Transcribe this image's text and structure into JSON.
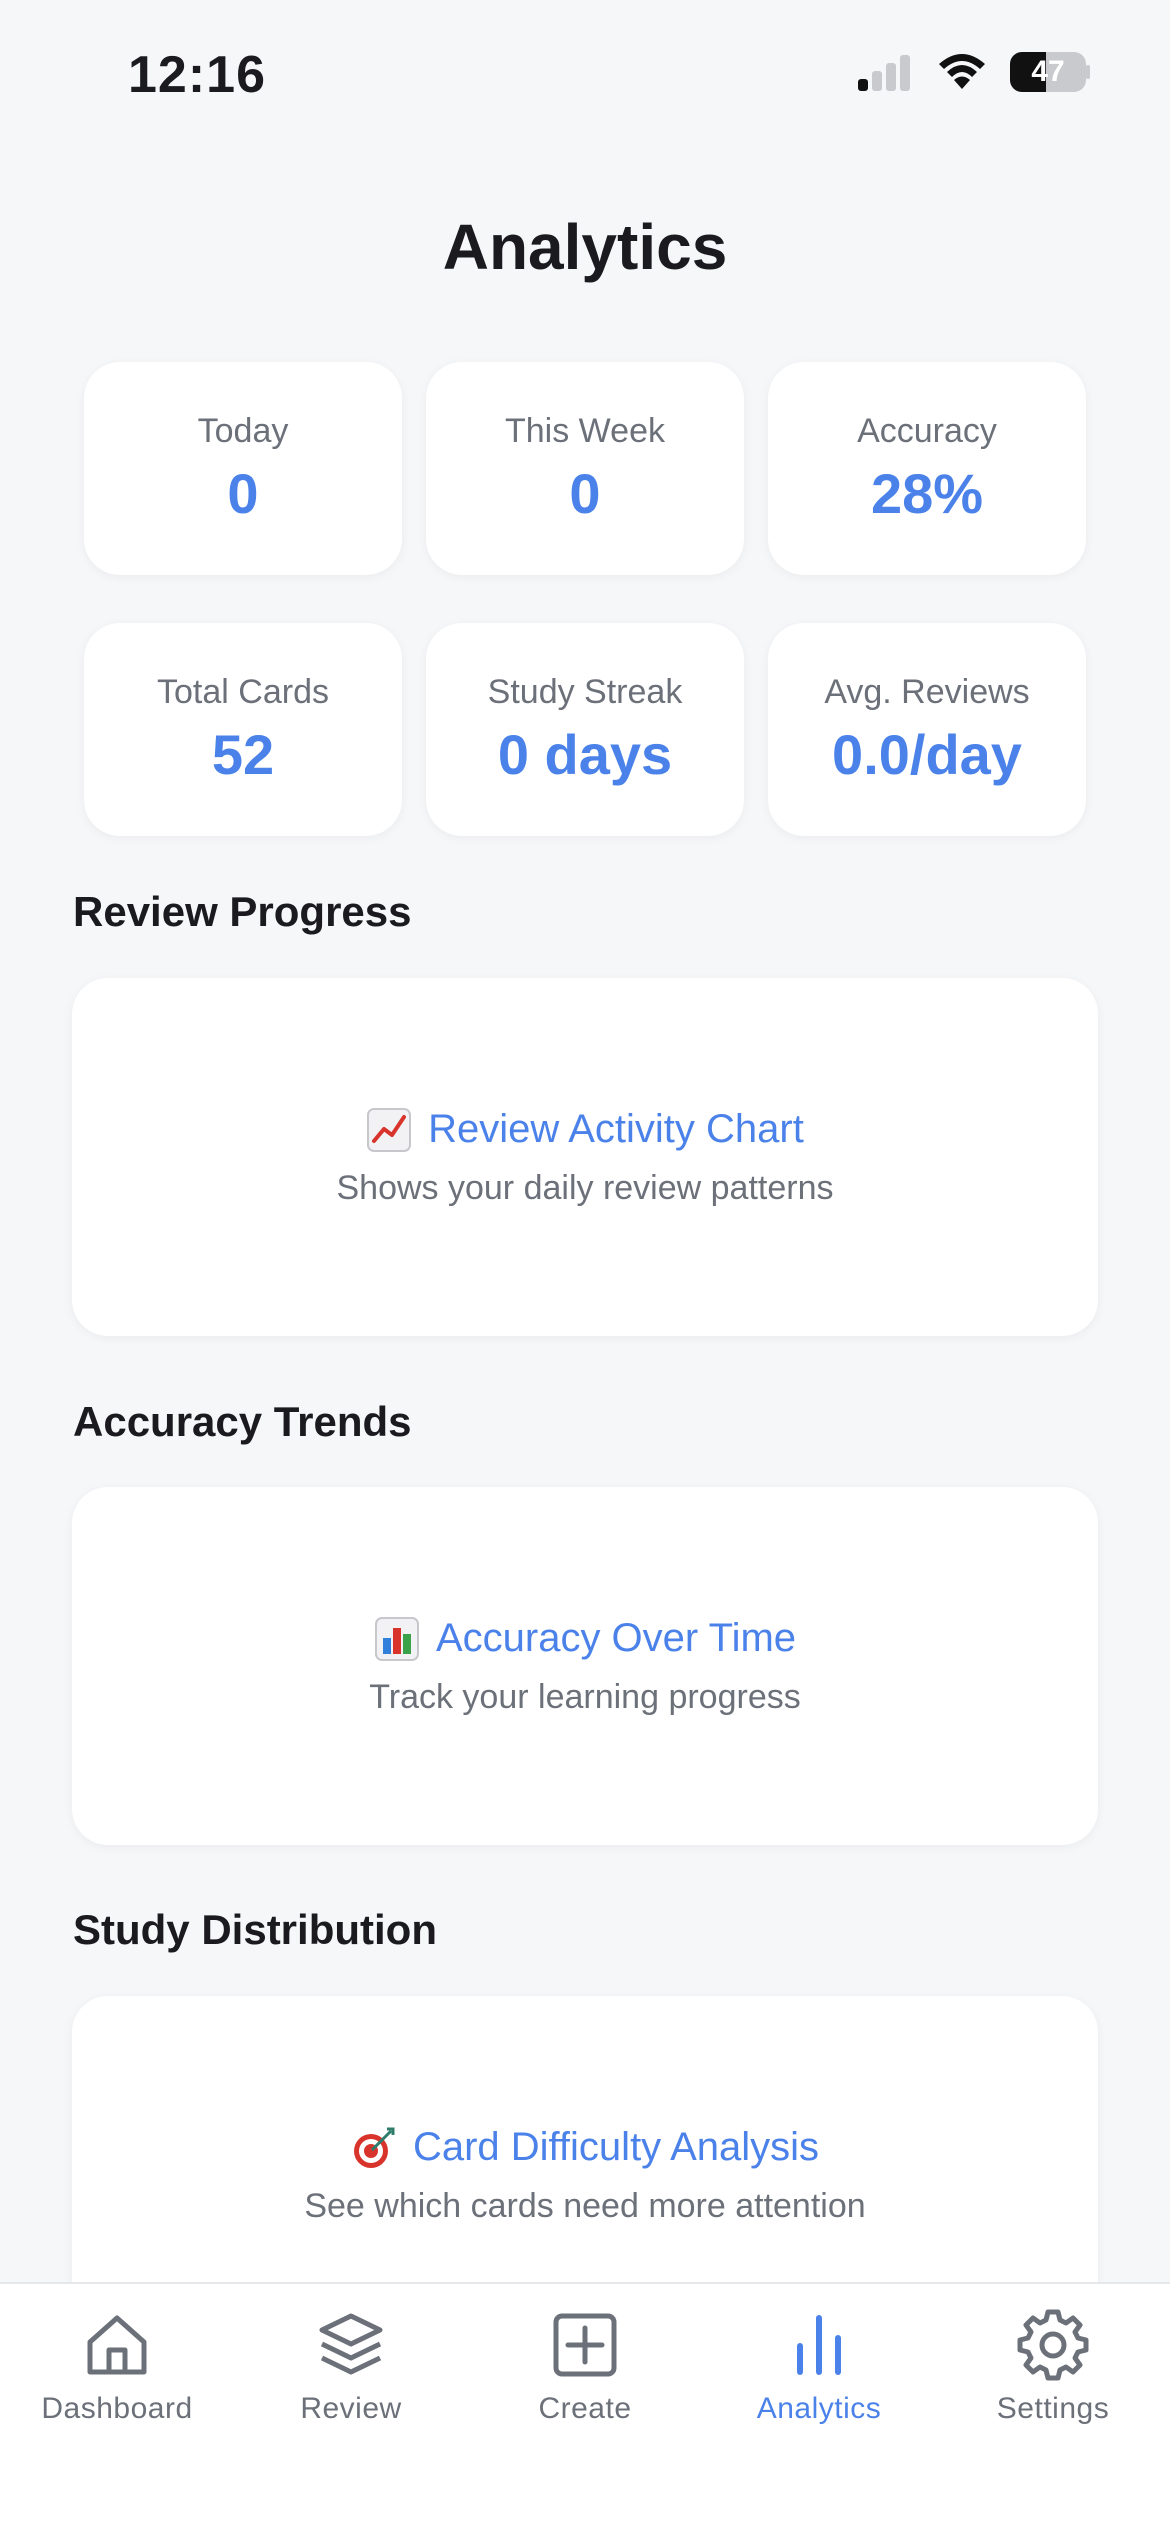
{
  "status_bar": {
    "time": "12:16",
    "battery_level": "47",
    "battery_fraction": 0.47,
    "icons": [
      "cellular-signal-icon",
      "wifi-icon",
      "battery-icon"
    ]
  },
  "header": {
    "title": "Analytics"
  },
  "stats": [
    {
      "label": "Today",
      "value": "0"
    },
    {
      "label": "This Week",
      "value": "0"
    },
    {
      "label": "Accuracy",
      "value": "28%"
    },
    {
      "label": "Total Cards",
      "value": "52"
    },
    {
      "label": "Study Streak",
      "value": "0 days"
    },
    {
      "label": "Avg. Reviews",
      "value": "0.0/day"
    }
  ],
  "sections": [
    {
      "title": "Review Progress",
      "card_icon": "chart-increasing-icon",
      "card_title": "Review Activity Chart",
      "card_subtitle": "Shows your daily review patterns"
    },
    {
      "title": "Accuracy Trends",
      "card_icon": "bar-chart-icon",
      "card_title": "Accuracy Over Time",
      "card_subtitle": "Track your learning progress"
    },
    {
      "title": "Study Distribution",
      "card_icon": "target-icon",
      "card_title": "Card Difficulty Analysis",
      "card_subtitle": "See which cards need more attention"
    }
  ],
  "tab_bar": {
    "items": [
      {
        "label": "Dashboard",
        "icon": "home-icon"
      },
      {
        "label": "Review",
        "icon": "layers-icon"
      },
      {
        "label": "Create",
        "icon": "plus-square-icon"
      },
      {
        "label": "Analytics",
        "icon": "bar-chart-icon"
      },
      {
        "label": "Settings",
        "icon": "gear-icon"
      }
    ],
    "active": "Analytics"
  },
  "colors": {
    "accent": "#4B82EA",
    "background": "#F6F7F9",
    "card": "#FFFFFF",
    "muted_text": "#6B7079",
    "primary_text": "#1B1B1F"
  }
}
